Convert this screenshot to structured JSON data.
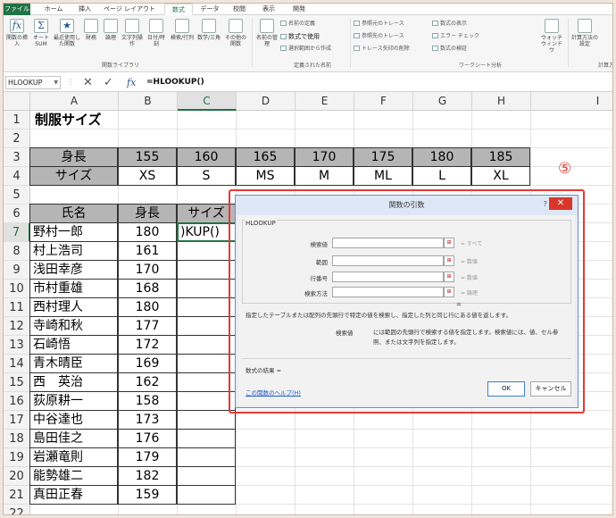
{
  "tabs": [
    "ファイル",
    "ホーム",
    "挿入",
    "ページ レイアウト",
    "数式",
    "データ",
    "校閲",
    "表示",
    "開発"
  ],
  "active_tab_index": 4,
  "ribbon": {
    "insert_function": "関数の挿入",
    "autosum": "オート SUM",
    "recent": "最近使用した関数",
    "financial": "財務",
    "logical": "論理",
    "text": "文字列操作",
    "datetime": "日付/時刻",
    "lookup": "検索/行列",
    "math": "数学/三角",
    "more": "その他の関数",
    "name_manager": "名前の管理",
    "define_name": "名前の定義",
    "use_in_formula": "数式で使用",
    "create_from_selection": "選択範囲から作成",
    "trace_precedents": "参照元のトレース",
    "trace_dependents": "参照先のトレース",
    "remove_arrows": "トレース矢印の削除",
    "show_formulas": "数式の表示",
    "error_check": "エラー チェック",
    "evaluate": "数式の検証",
    "watch": "ウォッチ ウィンドウ",
    "calc_options": "計算方法の設定",
    "group_library": "関数ライブラリ",
    "group_names": "定義された名前",
    "group_audit": "ワークシート分析",
    "group_calc": "計算方"
  },
  "formula_bar": {
    "name_box": "HLOOKUP",
    "fx": "fx",
    "cancel": "✕",
    "enter": "✓",
    "formula": "=HLOOKUP()"
  },
  "columns": [
    "A",
    "B",
    "C",
    "D",
    "E",
    "F",
    "G",
    "H",
    "I"
  ],
  "rows": [
    "1",
    "2",
    "3",
    "4",
    "5",
    "6",
    "7",
    "8",
    "9",
    "10",
    "11",
    "12",
    "13",
    "14",
    "15",
    "16",
    "17",
    "18",
    "19",
    "20",
    "21",
    "22"
  ],
  "sheet": {
    "title": "制服サイズ",
    "height_label": "身長",
    "size_label": "サイズ",
    "heights": [
      "155",
      "160",
      "165",
      "170",
      "175",
      "180",
      "185"
    ],
    "sizes": [
      "XS",
      "S",
      "MS",
      "M",
      "ML",
      "L",
      "XL"
    ],
    "table_headers": [
      "氏名",
      "身長",
      "サイズ"
    ],
    "active_cell_text": ")KUP()",
    "people": [
      {
        "name": "野村一郎",
        "height": "180"
      },
      {
        "name": "村上浩司",
        "height": "161"
      },
      {
        "name": "浅田幸彦",
        "height": "170"
      },
      {
        "name": "市村重雄",
        "height": "168"
      },
      {
        "name": "西村理人",
        "height": "180"
      },
      {
        "name": "寺崎和秋",
        "height": "177"
      },
      {
        "name": "石崎悟",
        "height": "172"
      },
      {
        "name": "青木晴臣",
        "height": "169"
      },
      {
        "name": "西　英治",
        "height": "162"
      },
      {
        "name": "荻原耕一",
        "height": "158"
      },
      {
        "name": "中谷達也",
        "height": "173"
      },
      {
        "name": "島田佳之",
        "height": "176"
      },
      {
        "name": "岩瀬竜則",
        "height": "179"
      },
      {
        "name": "能勢雄二",
        "height": "182"
      },
      {
        "name": "真田正春",
        "height": "159"
      }
    ]
  },
  "annotation": "⑤",
  "dialog": {
    "title": "関数の引数",
    "help": "?",
    "close": "✕",
    "function_name": "HLOOKUP",
    "args": [
      {
        "label": "検索値",
        "result": "= すべて"
      },
      {
        "label": "範囲",
        "result": "= 数値"
      },
      {
        "label": "行番号",
        "result": "= 数値"
      },
      {
        "label": "検索方法",
        "result": "= 論理"
      }
    ],
    "ref_btn": "⊞",
    "equals": "=",
    "description": "指定したテーブルまたは配列の先頭行で特定の値を検索し、指定した列と同じ行にある値を返します。",
    "arg_desc_label": "検索値",
    "arg_desc": "には範囲の先頭行で検索する値を指定します。検索値には、値、セル参照、または文字列を指定します。",
    "result_label": "数式の結果 =",
    "help_link": "この関数のヘルプ(H)",
    "ok": "OK",
    "cancel": "キャンセル"
  }
}
